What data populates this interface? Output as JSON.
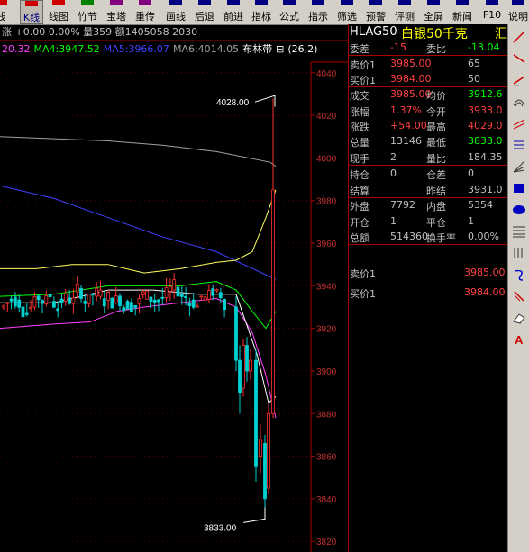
{
  "toolbar": {
    "items": [
      {
        "label": "线",
        "color": "#d00000"
      },
      {
        "label": "K线",
        "color": "#d00000"
      },
      {
        "label": "线图",
        "color": "#d00000"
      },
      {
        "label": "竹节",
        "color": "#008000"
      },
      {
        "label": "宝塔",
        "color": "#800080"
      },
      {
        "label": "重传",
        "color": "#800080"
      },
      {
        "label": "画线",
        "color": "#000080"
      },
      {
        "label": "后退",
        "color": "#000080"
      },
      {
        "label": "前进",
        "color": "#000080"
      },
      {
        "label": "指标",
        "color": "#000080"
      },
      {
        "label": "公式",
        "color": "#000080"
      },
      {
        "label": "指示",
        "color": "#000080"
      },
      {
        "label": "筛选",
        "color": "#000080"
      },
      {
        "label": "预警",
        "color": "#000080"
      },
      {
        "label": "评测",
        "color": "#000080"
      },
      {
        "label": "全屏",
        "color": "#000080"
      },
      {
        "label": "新闻",
        "color": "#000080"
      },
      {
        "label": "F10",
        "color": "#000080"
      },
      {
        "label": "说明",
        "color": "#000080"
      }
    ]
  },
  "info_line": "涨 +0.00  0.00% 量359 额1405058 2030",
  "ma_line": [
    {
      "text": "20.32",
      "color": "#ff40ff"
    },
    {
      "text": "MA4:3947.52",
      "color": "#00ff00"
    },
    {
      "text": "MA5:3966.07",
      "color": "#4040ff"
    },
    {
      "text": "MA6:4014.05",
      "color": "#a0a0a0"
    },
    {
      "text": "布林带",
      "color": "#ffffff"
    },
    {
      "text": "⊟",
      "color": "#ffffff"
    },
    {
      "text": "(26,2)",
      "color": "#ffffff"
    }
  ],
  "chart_data": {
    "type": "candlestick",
    "y_ticks": [
      "4040",
      "4020",
      "4000",
      "3980",
      "3960",
      "3940",
      "3920",
      "3900",
      "3880",
      "3860",
      "3840",
      "3820"
    ],
    "high_label": "4028.00",
    "low_label": "3833.00",
    "ylim": [
      3815,
      4045
    ]
  },
  "panel": {
    "code": "HLAG50",
    "name": "白银50千克",
    "suffix": "汇",
    "rows": [
      {
        "l": "委差",
        "v": "-15",
        "vc": "#ff4040",
        "l2": "委比",
        "v2": "-13.04",
        "v2c": "#00ff00"
      },
      {
        "l": "卖价1",
        "v": "3985.00",
        "vc": "#ff4040",
        "l2": "",
        "v2": "65",
        "v2c": "#c0c0c0"
      },
      {
        "l": "买价1",
        "v": "3984.00",
        "vc": "#ff4040",
        "l2": "",
        "v2": "50",
        "v2c": "#c0c0c0"
      },
      {
        "l": "成交",
        "v": "3985.00",
        "vc": "#ff4040",
        "l2": "均价",
        "v2": "3912.6",
        "v2c": "#00ff00"
      },
      {
        "l": "涨幅",
        "v": "1.37%",
        "vc": "#ff4040",
        "l2": "今开",
        "v2": "3933.0",
        "v2c": "#ff4040"
      },
      {
        "l": "涨跌",
        "v": "+54.00",
        "vc": "#ff4040",
        "l2": "最高",
        "v2": "4029.0",
        "v2c": "#ff4040"
      },
      {
        "l": "总量",
        "v": "13146",
        "vc": "#c0c0c0",
        "l2": "最低",
        "v2": "3833.0",
        "v2c": "#00ff00"
      },
      {
        "l": "现手",
        "v": "2",
        "vc": "#c0c0c0",
        "l2": "量比",
        "v2": "184.35",
        "v2c": "#c0c0c0"
      },
      {
        "l": "持仓",
        "v": "0",
        "vc": "#c0c0c0",
        "l2": "仓差",
        "v2": "0",
        "v2c": "#c0c0c0"
      },
      {
        "l": "结算",
        "v": "",
        "vc": "#c0c0c0",
        "l2": "昨结",
        "v2": "3931.0",
        "v2c": "#c0c0c0"
      },
      {
        "l": "外盘",
        "v": "7792",
        "vc": "#c0c0c0",
        "l2": "内盘",
        "v2": "5354",
        "v2c": "#c0c0c0"
      },
      {
        "l": "开仓",
        "v": "1",
        "vc": "#c0c0c0",
        "l2": "平仓",
        "v2": "1",
        "v2c": "#c0c0c0"
      },
      {
        "l": "总额",
        "v": "514360",
        "vc": "#c0c0c0",
        "l2": "换手率",
        "v2": "0.00%",
        "v2c": "#c0c0c0"
      }
    ],
    "ask_label": "卖价1",
    "ask_value": "3985.00",
    "bid_label": "买价1",
    "bid_value": "3984.00"
  }
}
